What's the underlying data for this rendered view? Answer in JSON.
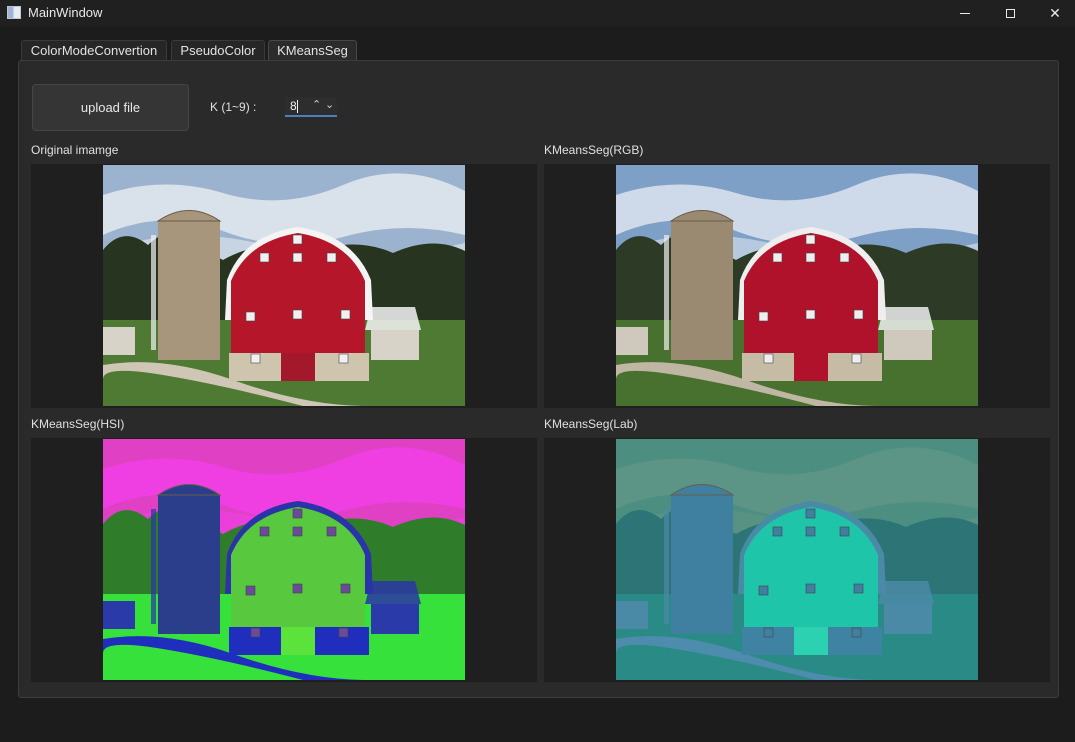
{
  "window": {
    "title": "MainWindow"
  },
  "tabs": [
    {
      "label": "ColorModeConvertion"
    },
    {
      "label": "PseudoColor"
    },
    {
      "label": "KMeansSeg"
    }
  ],
  "controls": {
    "upload_label": "upload file",
    "k_label": "K (1~9) :",
    "k_value": "8",
    "spin_up": "⌃",
    "spin_down": "⌄"
  },
  "panels": {
    "original": {
      "label": "Original imamge"
    },
    "rgb": {
      "label": "KMeansSeg(RGB)"
    },
    "hsi": {
      "label": "KMeansSeg(HSI)"
    },
    "lab": {
      "label": "KMeansSeg(Lab)"
    }
  },
  "palettes": {
    "original": {
      "sky": "#9cb3cf",
      "cloud": "#e4e9ef",
      "trees": "#27341f",
      "field": "#4f7a33",
      "road": "#cfc6b5",
      "silo": "#a7957c",
      "barn": "#b5162a",
      "roof": "#f4f4f4",
      "stone": "#cfc4ae",
      "shed": "#d8d3c8",
      "door": "#a3182a",
      "window": "#f0f0f0"
    },
    "rgb": {
      "sky": "#7ea0c6",
      "cloud": "#dce4ee",
      "trees": "#2c3a26",
      "field": "#48702e",
      "road": "#bfb6a3",
      "silo": "#9b8a72",
      "barn": "#b1122b",
      "roof": "#eeeeee",
      "stone": "#c6bba5",
      "shed": "#cfc9bd",
      "door": "#b1122b",
      "window": "#eeeeee"
    },
    "hsi": {
      "sky": "#e040c4",
      "cloud": "#f13fe7",
      "trees": "#2f7d2a",
      "field": "#35e13a",
      "road": "#1f2ebd",
      "silo": "#2b3e8c",
      "barn": "#58c93e",
      "roof": "#2a34a8",
      "stone": "#1f2ebd",
      "shed": "#2a3aa9",
      "door": "#5be33c",
      "window": "#6a4a9a"
    },
    "lab": {
      "sky": "#4c8f80",
      "cloud": "#5f9586",
      "trees": "#2c7476",
      "field": "#2a8a86",
      "road": "#4e8cad",
      "silo": "#3f7fa0",
      "barn": "#1ec5a8",
      "roof": "#4b8aa6",
      "stone": "#3f83a3",
      "shed": "#4b8aa6",
      "door": "#2bd1b1",
      "window": "#3f7fa0"
    }
  }
}
